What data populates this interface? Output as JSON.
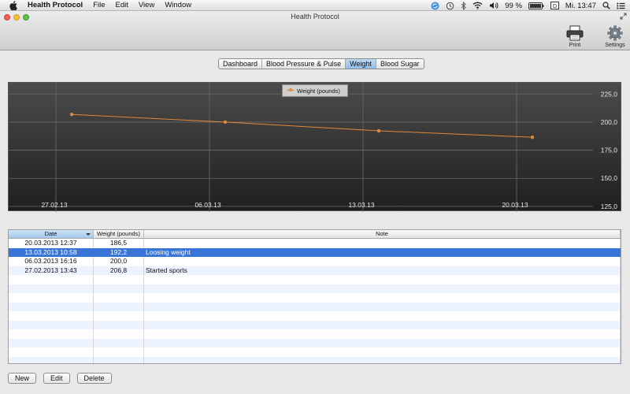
{
  "menubar": {
    "app_name": "Health Protocol",
    "items": [
      "File",
      "Edit",
      "View",
      "Window"
    ],
    "battery": "99 %",
    "clock": "Mi. 13:47"
  },
  "window": {
    "title": "Health Protocol",
    "toolbar": {
      "print_label": "Print",
      "settings_label": "Settings"
    }
  },
  "tabs": [
    {
      "label": "Dashboard",
      "active": false
    },
    {
      "label": "Blood Pressure & Pulse",
      "active": false
    },
    {
      "label": "Weight",
      "active": true
    },
    {
      "label": "Blood Sugar",
      "active": false
    }
  ],
  "chart_data": {
    "type": "line",
    "series": [
      {
        "name": "Weight (pounds)",
        "color": "#e0893a",
        "x": [
          "27.02.13",
          "06.03.13",
          "13.03.13",
          "20.03.13"
        ],
        "values": [
          206.8,
          200.0,
          192.2,
          186.5
        ]
      }
    ],
    "x_ticks": [
      "27.02.13",
      "06.03.13",
      "13.03.13",
      "20.03.13"
    ],
    "y_ticks": [
      "225,0",
      "200,0",
      "175,0",
      "150,0",
      "125,0"
    ],
    "y_tick_values": [
      225,
      200,
      175,
      150,
      125
    ],
    "ylim": [
      120,
      235
    ],
    "legend_position": "top-center",
    "grid": true
  },
  "table": {
    "columns": [
      "Date",
      "Weight (pounds)",
      "Note"
    ],
    "sorted_column": "Date",
    "rows": [
      {
        "date": "20.03.2013 12:37",
        "weight": "186,5",
        "note": ""
      },
      {
        "date": "13.03.2013 10:58",
        "weight": "192,2",
        "note": "Loosing weight"
      },
      {
        "date": "06.03.2013 16:16",
        "weight": "200,0",
        "note": ""
      },
      {
        "date": "27.02.2013 13:43",
        "weight": "206,8",
        "note": "Started sports"
      }
    ],
    "selected_row": 1
  },
  "buttons": {
    "new": "New",
    "edit": "Edit",
    "delete": "Delete"
  }
}
